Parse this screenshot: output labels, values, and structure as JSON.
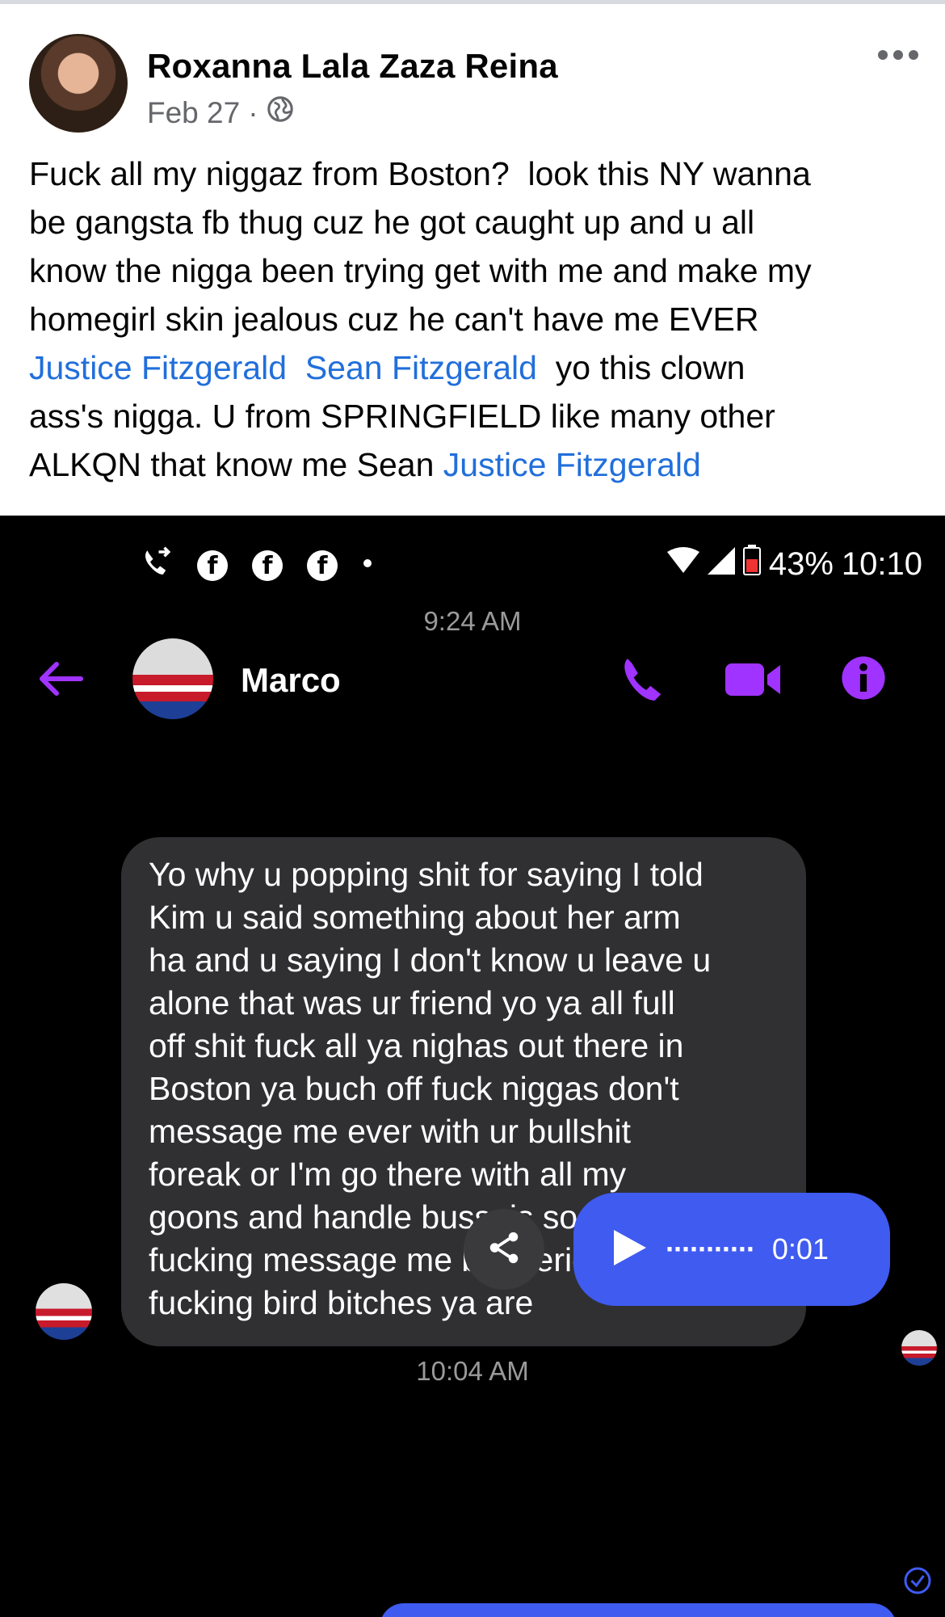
{
  "post": {
    "author": "Roxanna Lala Zaza Reina",
    "date": "Feb 27",
    "separator": "·",
    "privacy_icon": "globe-icon",
    "more_icon": "more-icon",
    "text_lines": [
      [
        {
          "t": "Fuck all my niggaz from Boston?  look this NY wanna"
        }
      ],
      [
        {
          "t": "be gangsta fb thug cuz he got caught up and u all"
        }
      ],
      [
        {
          "t": "know the nigga been trying get with me and make my"
        }
      ],
      [
        {
          "t": "homegirl skin jealous cuz he can't have me EVER"
        }
      ],
      [
        {
          "t": "Justice Fitzgerald",
          "link": true
        },
        {
          "t": "  "
        },
        {
          "t": "Sean Fitzgerald",
          "link": true
        },
        {
          "t": "  yo this clown"
        }
      ],
      [
        {
          "t": "ass's nigga. U from SPRINGFIELD like many other"
        }
      ],
      [
        {
          "t": "ALKQN that know me Sean "
        },
        {
          "t": "Justice Fitzgerald",
          "link": true
        }
      ]
    ]
  },
  "phone": {
    "status": {
      "battery": "43%",
      "time": "10:10",
      "icons": [
        "call-forward-icon",
        "facebook-icon",
        "facebook-icon",
        "facebook-icon",
        "dot-icon",
        "wifi-icon",
        "signal-icon",
        "battery-icon"
      ]
    },
    "messenger": {
      "contact_name": "Marco",
      "accent": "#a033ff",
      "header_icons": [
        "back-arrow-icon",
        "phone-icon",
        "video-icon",
        "info-icon"
      ]
    },
    "timestamps": [
      "9:24 AM",
      "10:04 AM"
    ],
    "message": {
      "lines": [
        "Yo why u popping shit for saying I told",
        "Kim u said something about her arm",
        "ha and u saying I don't know u leave u",
        "alone that was ur friend yo ya all full",
        "off shit fuck all ya nighas out there in",
        "Boston ya buch off fuck niggas don't",
        "message me ever with ur bullshit",
        "foreak or I'm go there with all my",
        "goons and handle bussnis so don't",
        "fucking message me bro serious",
        "fucking bird bitches ya are"
      ]
    },
    "audio": {
      "dots": "···········",
      "duration": "0:01",
      "bubble_color": "#3f5bf0"
    }
  }
}
